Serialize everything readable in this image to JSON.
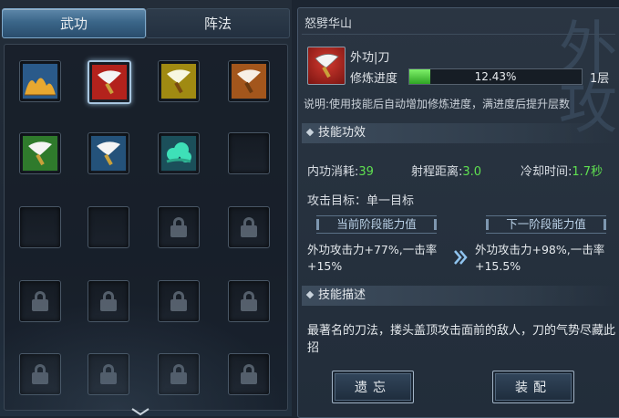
{
  "tabs": [
    {
      "label": "武功",
      "active": true
    },
    {
      "label": "阵法",
      "active": false
    }
  ],
  "skill_slots": [
    {
      "icon": "golden-mountain-icon",
      "state": "skill"
    },
    {
      "icon": "red-blade-icon",
      "state": "skill-selected"
    },
    {
      "icon": "yellow-blade-icon",
      "state": "skill"
    },
    {
      "icon": "orange-blade-icon",
      "state": "skill"
    },
    {
      "icon": "green-blade-icon",
      "state": "skill"
    },
    {
      "icon": "blue-blade-icon",
      "state": "skill"
    },
    {
      "icon": "teal-cloud-icon",
      "state": "skill"
    },
    {
      "icon": "",
      "state": "empty"
    },
    {
      "icon": "",
      "state": "empty"
    },
    {
      "icon": "",
      "state": "empty"
    },
    {
      "icon": "lock-icon",
      "state": "locked"
    },
    {
      "icon": "lock-icon",
      "state": "locked"
    },
    {
      "icon": "lock-icon",
      "state": "locked"
    },
    {
      "icon": "lock-icon",
      "state": "locked"
    },
    {
      "icon": "lock-icon",
      "state": "locked"
    },
    {
      "icon": "lock-icon",
      "state": "locked"
    },
    {
      "icon": "lock-icon",
      "state": "locked"
    },
    {
      "icon": "lock-icon",
      "state": "locked"
    },
    {
      "icon": "lock-icon",
      "state": "locked"
    },
    {
      "icon": "lock-icon",
      "state": "locked"
    }
  ],
  "skill": {
    "name": "怒劈华山",
    "type": "外功|刀",
    "progress_label": "修炼进度",
    "progress_value": "12.43%",
    "progress_fraction": 0.1243,
    "level": "1层",
    "note": "说明:使用技能后自动增加修炼进度，满进度后提升层数"
  },
  "effects": {
    "header": "技能功效",
    "stats": [
      {
        "label": "内功消耗:",
        "value": "39"
      },
      {
        "label": "射程距离:",
        "value": "3.0"
      },
      {
        "label": "冷却时间:",
        "value": "1.7秒"
      }
    ],
    "target": "攻击目标：单一目标",
    "current_label": "当前阶段能力值",
    "next_label": "下一阶段能力值",
    "current_value": "外功攻击力+77%,一击率+15%",
    "next_value": "外功攻击力+98%,一击率+15.5%"
  },
  "description": {
    "header": "技能描述",
    "text": "最著名的刀法，搂头盖顶攻击面前的敌人，刀的气势尽藏此招"
  },
  "buttons": {
    "forget": "遗忘",
    "equip": "装配"
  },
  "colors": {
    "accent": "#5fe050",
    "panel": "#222d3a",
    "tab_active": "#3b6689"
  }
}
